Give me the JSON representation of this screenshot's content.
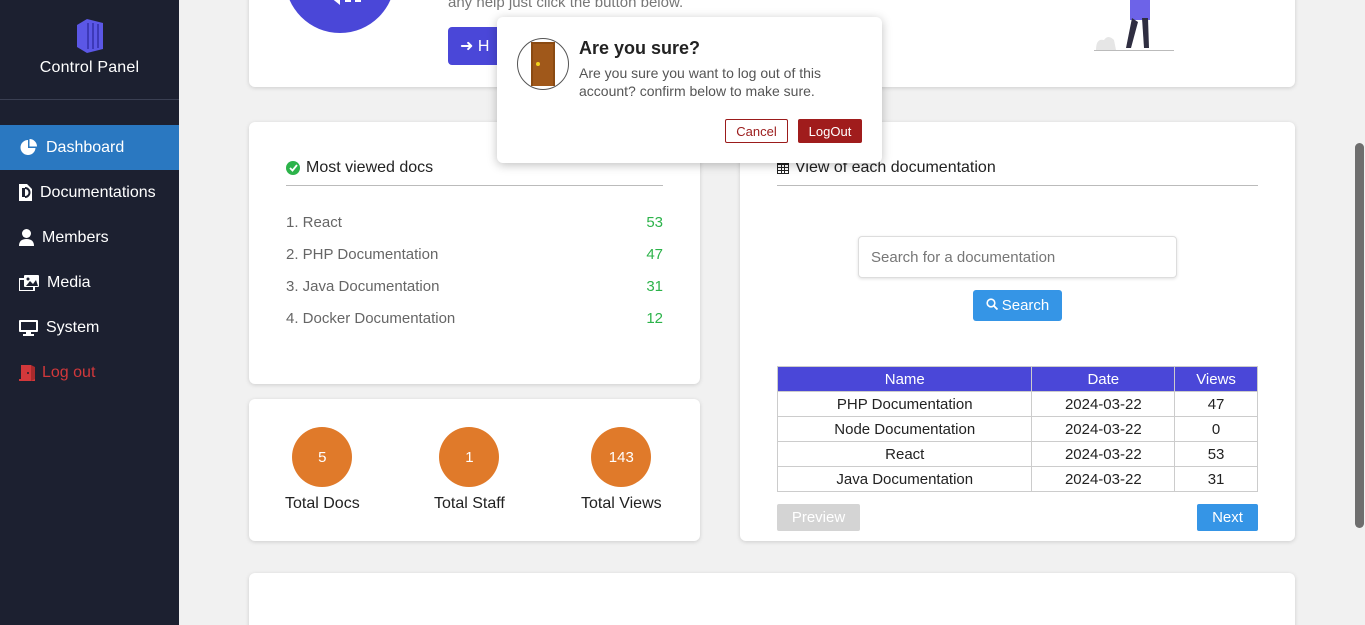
{
  "sidebar": {
    "title": "Control Panel",
    "items": [
      {
        "label": "Dashboard",
        "icon": "pie-chart-icon"
      },
      {
        "label": "Documentations",
        "icon": "document-icon"
      },
      {
        "label": "Members",
        "icon": "user-icon"
      },
      {
        "label": "Media",
        "icon": "images-icon"
      },
      {
        "label": "System",
        "icon": "monitor-icon"
      },
      {
        "label": "Log out",
        "icon": "door-icon"
      }
    ]
  },
  "hero": {
    "text": "any help just click the button below.",
    "button_label": "H"
  },
  "most_viewed": {
    "title": "Most viewed docs",
    "items": [
      {
        "name": "1. React",
        "count": "53"
      },
      {
        "name": "2. PHP Documentation",
        "count": "47"
      },
      {
        "name": "3. Java Documentation",
        "count": "31"
      },
      {
        "name": "4. Docker Documentation",
        "count": "12"
      }
    ]
  },
  "stats": [
    {
      "value": "5",
      "label": "Total Docs"
    },
    {
      "value": "1",
      "label": "Total Staff"
    },
    {
      "value": "143",
      "label": "Total Views"
    }
  ],
  "view_each": {
    "title": "View of each documentation",
    "search_placeholder": "Search for a documentation",
    "search_button": "Search",
    "columns": [
      "Name",
      "Date",
      "Views"
    ],
    "rows": [
      [
        "PHP Documentation",
        "2024-03-22",
        "47"
      ],
      [
        "Node Documentation",
        "2024-03-22",
        "0"
      ],
      [
        "React",
        "2024-03-22",
        "53"
      ],
      [
        "Java Documentation",
        "2024-03-22",
        "31"
      ]
    ],
    "prev_label": "Preview",
    "next_label": "Next"
  },
  "modal": {
    "title": "Are you sure?",
    "text": "Are you sure you want to log out of this account? confirm below to make sure.",
    "cancel_label": "Cancel",
    "logout_label": "LogOut"
  },
  "colors": {
    "sidebar_bg": "#1c2030",
    "active": "#2a78c1",
    "accent": "#4a47d8",
    "orange": "#e07a2a",
    "green": "#2cb34a",
    "danger": "#a01c1c",
    "blue_button": "#3595e6"
  }
}
